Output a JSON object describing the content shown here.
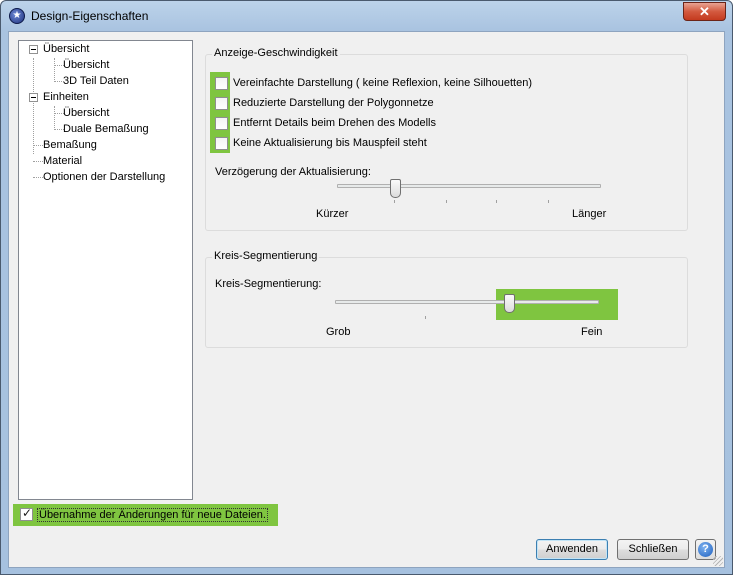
{
  "window": {
    "title": "Design-Eigenschaften",
    "close_label": "✕"
  },
  "tree": {
    "items": [
      {
        "label": "Übersicht"
      },
      {
        "label": "Übersicht"
      },
      {
        "label": "3D Teil Daten"
      },
      {
        "label": "Einheiten"
      },
      {
        "label": "Übersicht"
      },
      {
        "label": "Duale Bemaßung"
      },
      {
        "label": "Bemaßung"
      },
      {
        "label": "Material"
      },
      {
        "label": "Optionen der Darstellung"
      }
    ]
  },
  "speed_group": {
    "title": "Anzeige-Geschwindigkeit",
    "checkboxes": [
      {
        "label": "Vereinfachte Darstellung ( keine Reflexion, keine Silhouetten)",
        "checked": false
      },
      {
        "label": "Reduzierte Darstellung der Polygonnetze",
        "checked": false
      },
      {
        "label": "Entfernt Details beim Drehen des Modells",
        "checked": false
      },
      {
        "label": "Keine Aktualisierung bis Mauspfeil steht",
        "checked": false
      }
    ],
    "delay_label": "Verzögerung der Aktualisierung:",
    "delay_min": "Kürzer",
    "delay_max": "Länger",
    "delay_value": 0.22
  },
  "circle_group": {
    "title": "Kreis-Segmentierung",
    "label": "Kreis-Segmentierung:",
    "min": "Grob",
    "max": "Fein",
    "value": 0.66
  },
  "apply_new_files": {
    "label": "Übernahme der Änderungen für neue Dateien.",
    "checked": true,
    "check_glyph": "✓"
  },
  "buttons": {
    "apply": "Anwenden",
    "close": "Schließen",
    "help_glyph": "?"
  },
  "colors": {
    "highlight": "#7fc540",
    "title_bar": "#a9c3e0"
  }
}
